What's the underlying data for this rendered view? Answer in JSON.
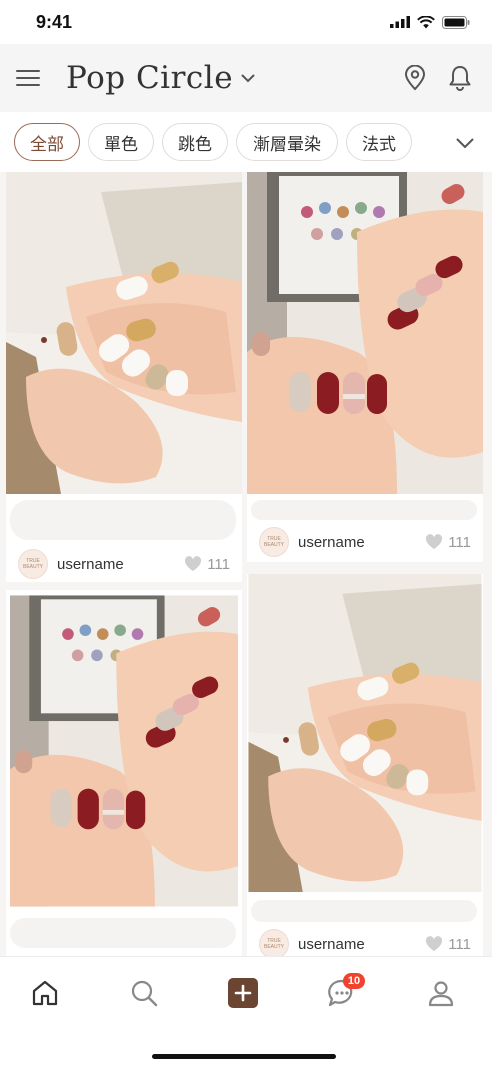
{
  "status": {
    "time": "9:41"
  },
  "header": {
    "title": "Pop Circle"
  },
  "tabs": [
    {
      "label": "全部",
      "active": true
    },
    {
      "label": "單色",
      "active": false
    },
    {
      "label": "跳色",
      "active": false
    },
    {
      "label": "漸層暈染",
      "active": false
    },
    {
      "label": "法式",
      "active": false
    }
  ],
  "posts": [
    {
      "username": "username",
      "likes": "111",
      "avatar_text": "TRUE BEAUTY"
    },
    {
      "username": "username",
      "likes": "111",
      "avatar_text": "TRUE BEAUTY"
    },
    {
      "username": "username",
      "likes": "111",
      "avatar_text": "TRUE BEAUTY"
    }
  ],
  "nav": {
    "messages_badge": "10"
  },
  "colors": {
    "accent": "#9a6b55",
    "create_button": "#6b4532",
    "badge": "#f0422d"
  },
  "icons": [
    "menu-icon",
    "chevron-down-icon",
    "location-icon",
    "bell-icon",
    "heart-icon",
    "home-icon",
    "search-icon",
    "plus-icon",
    "chat-icon",
    "profile-icon"
  ]
}
